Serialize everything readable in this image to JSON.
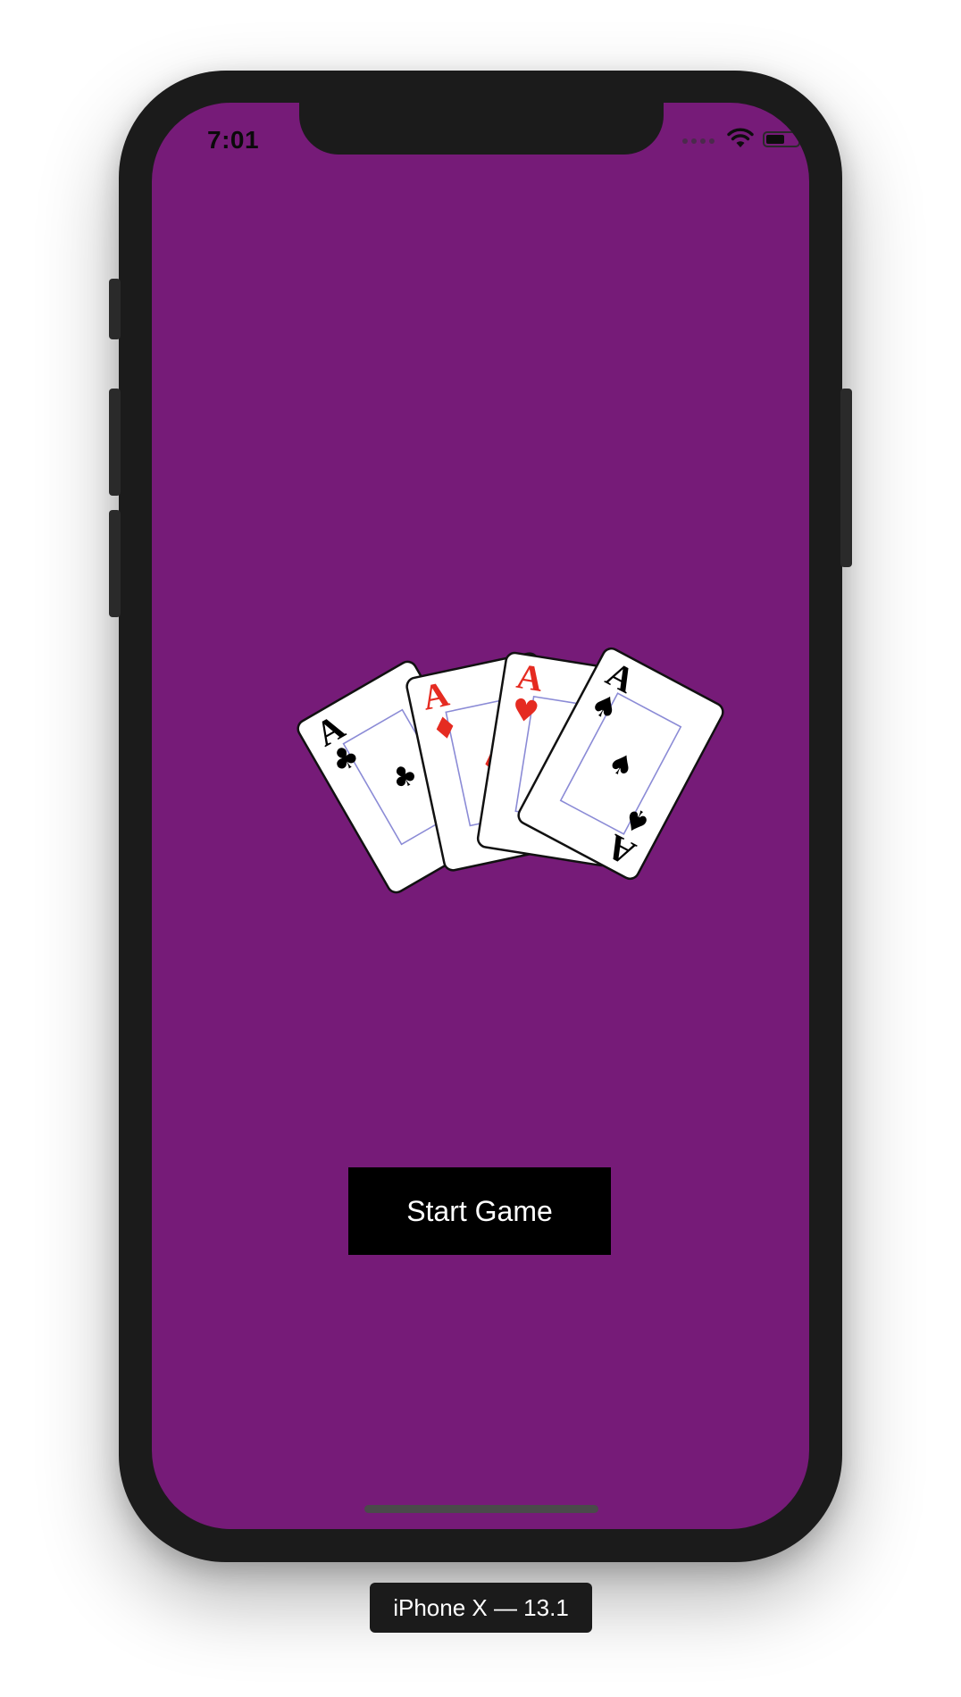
{
  "status_bar": {
    "time": "7:01"
  },
  "theme": {
    "background": "#761b78",
    "button_background": "#000000",
    "button_text": "#ffffff"
  },
  "cards": [
    {
      "rank": "A",
      "suit": "clubs",
      "symbol": "♣",
      "color": "#000000"
    },
    {
      "rank": "A",
      "suit": "diamonds",
      "symbol": "♦",
      "color": "#e52b21"
    },
    {
      "rank": "A",
      "suit": "hearts",
      "symbol": "♥",
      "color": "#e52b21"
    },
    {
      "rank": "A",
      "suit": "spades",
      "symbol": "♠",
      "color": "#000000"
    }
  ],
  "main": {
    "start_button_label": "Start Game"
  },
  "simulator": {
    "device_label": "iPhone X — 13.1"
  }
}
